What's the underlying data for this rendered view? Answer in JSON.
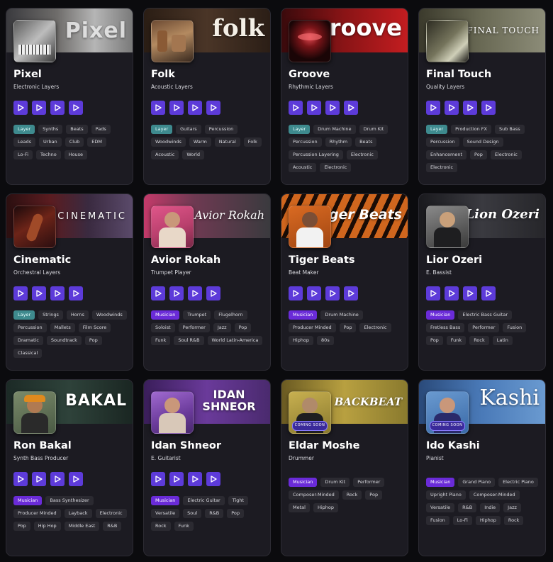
{
  "colors": {
    "page_background": "#0b0b0e",
    "card_background": "#1c1b22",
    "play_button": "#5d3bd9",
    "layer_tag": "#3e8a8e",
    "musician_tag": "#6a2bd8",
    "tag_background": "#2b2a31"
  },
  "cards": [
    {
      "banner_text": "Pixel",
      "title": "Pixel",
      "subtitle": "Electronic Layers",
      "coming_soon": "",
      "tags": [
        "Layer",
        "Synths",
        "Beats",
        "Pads",
        "Leads",
        "Urban",
        "Club",
        "EDM",
        "Lo-Fi",
        "Techno",
        "House"
      ]
    },
    {
      "banner_text": "folk",
      "title": "Folk",
      "subtitle": "Acoustic Layers",
      "coming_soon": "",
      "tags": [
        "Layer",
        "Guitars",
        "Percussion",
        "Woodwinds",
        "Warm",
        "Natural",
        "Folk",
        "Acoustic",
        "World"
      ]
    },
    {
      "banner_text": "groove",
      "title": "Groove",
      "subtitle": "Rhythmic Layers",
      "coming_soon": "",
      "tags": [
        "Layer",
        "Drum Machine",
        "Drum Kit",
        "Percussion",
        "Rhythm",
        "Beats",
        "Percussion Layering",
        "Electronic",
        "Acoustic",
        "Electronic"
      ]
    },
    {
      "banner_text": "FINAL TOUCH",
      "title": "Final Touch",
      "subtitle": "Quality Layers",
      "coming_soon": "",
      "tags": [
        "Layer",
        "Production FX",
        "Sub Bass",
        "Percussion",
        "Sound Design",
        "Enhancement",
        "Pop",
        "Electronic",
        "Electronic"
      ]
    },
    {
      "banner_text": "CINEMATIC",
      "title": "Cinematic",
      "subtitle": "Orchestral Layers",
      "coming_soon": "",
      "tags": [
        "Layer",
        "Strings",
        "Horns",
        "Woodwinds",
        "Percussion",
        "Mallets",
        "Film Score",
        "Dramatic",
        "Soundtrack",
        "Pop",
        "Classical"
      ]
    },
    {
      "banner_text": "Avior Rokah",
      "title": "Avior Rokah",
      "subtitle": "Trumpet Player",
      "coming_soon": "",
      "tags": [
        "Musician",
        "Trumpet",
        "Flugelhorn",
        "Soloist",
        "Performer",
        "Jazz",
        "Pop",
        "Funk",
        "Soul R&B",
        "World Latin-America"
      ]
    },
    {
      "banner_text": "Tiger Beats",
      "title": "Tiger Beats",
      "subtitle": "Beat Maker",
      "coming_soon": "",
      "tags": [
        "Musician",
        "Drum Machine",
        "Producer Minded",
        "Pop",
        "Electronic",
        "Hiphop",
        "80s"
      ]
    },
    {
      "banner_text": "Lion Ozeri",
      "title": "Lior Ozeri",
      "subtitle": "E. Bassist",
      "coming_soon": "",
      "tags": [
        "Musician",
        "Electric Bass Guitar",
        "Fretless Bass",
        "Performer",
        "Fusion",
        "Pop",
        "Funk",
        "Rock",
        "Latin"
      ]
    },
    {
      "banner_text": "BAKAL",
      "title": "Ron Bakal",
      "subtitle": "Synth Bass Producer",
      "coming_soon": "",
      "tags": [
        "Musician",
        "Bass Synthesizer",
        "Producer Minded",
        "Layback",
        "Electronic",
        "Pop",
        "Hip Hop",
        "Middle East",
        "R&B"
      ]
    },
    {
      "banner_text": "IDAN SHNEOR",
      "title": "Idan Shneor",
      "subtitle": "E. Guitarist",
      "coming_soon": "",
      "tags": [
        "Musician",
        "Electric Guitar",
        "Tight",
        "Versatile",
        "Soul",
        "R&B",
        "Pop",
        "Rock",
        "Funk"
      ]
    },
    {
      "banner_text": "The BACKBEAT",
      "title": "Eldar Moshe",
      "subtitle": "Drummer",
      "coming_soon": "COMING SOON",
      "tags": [
        "Musician",
        "Drum Kit",
        "Performer",
        "Composer-Minded",
        "Rock",
        "Pop",
        "Metal",
        "Hiphop"
      ]
    },
    {
      "banner_text": "Kashi",
      "title": "Ido Kashi",
      "subtitle": "Pianist",
      "coming_soon": "COMING SOON",
      "tags": [
        "Musician",
        "Grand Piano",
        "Electric Piano",
        "Upright Piano",
        "Composer-Minded",
        "Versatile",
        "R&B",
        "Indie",
        "Jazz",
        "Fusion",
        "Lo-Fi",
        "Hiphop",
        "Rock"
      ]
    }
  ]
}
